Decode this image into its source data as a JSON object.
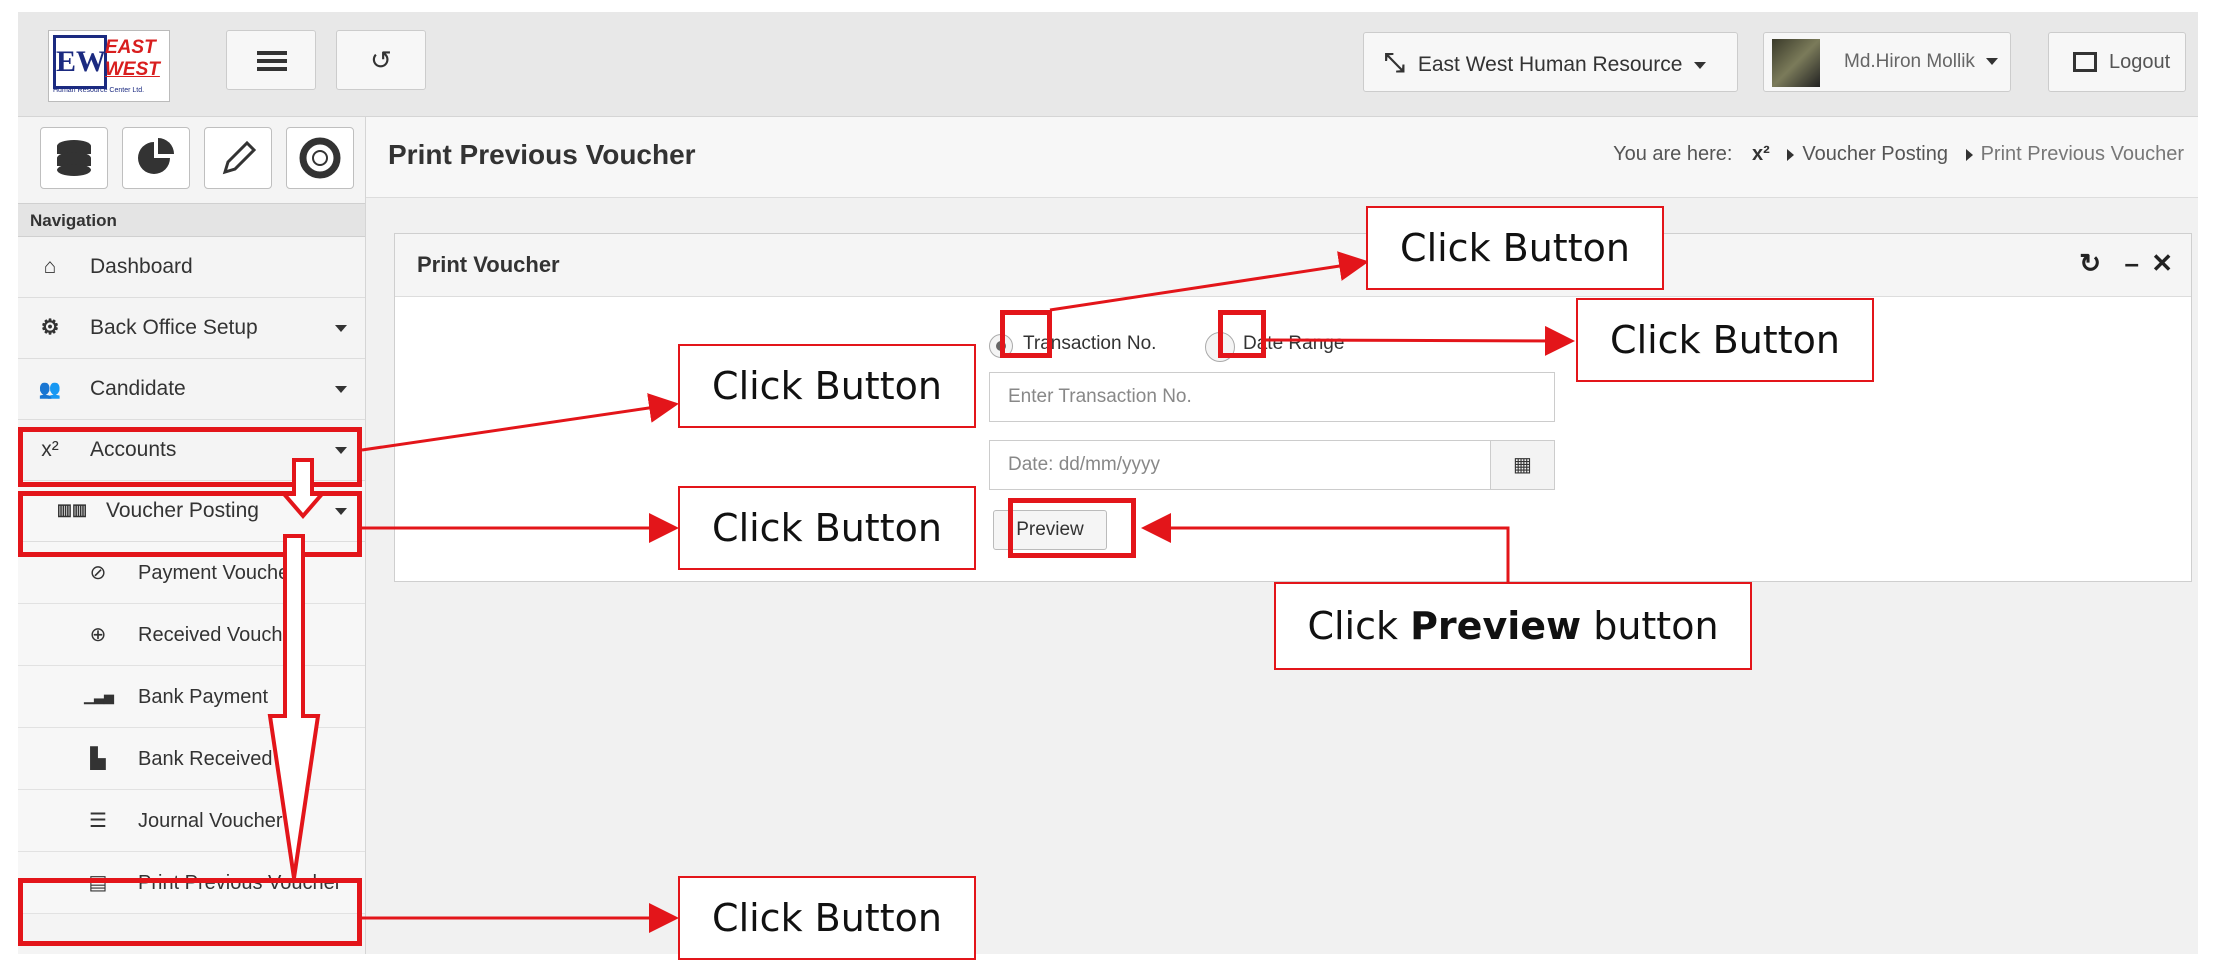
{
  "header": {
    "logo": {
      "mark": "EW",
      "line1": "EAST",
      "line2": "WEST",
      "tagline": "Human Resource Center Ltd."
    },
    "company_label": "East West Human Resource",
    "user_name": "Md.Hiron Mollik",
    "logout_label": "Logout"
  },
  "sidebar": {
    "nav_header": "Navigation",
    "items": [
      {
        "label": "Dashboard",
        "icon": "home-icon",
        "glyph": "⌂"
      },
      {
        "label": "Back Office Setup",
        "icon": "cogs-icon",
        "glyph": "⚙"
      },
      {
        "label": "Candidate",
        "icon": "users-icon",
        "glyph": "👥"
      },
      {
        "label": "Accounts",
        "icon": "superscript-icon",
        "glyph": "x²"
      },
      {
        "label": "Voucher Posting",
        "icon": "columns-icon",
        "glyph": "▥▥"
      }
    ],
    "sub_items": [
      {
        "label": "Payment Voucher",
        "icon": "compass-icon",
        "glyph": "⊘"
      },
      {
        "label": "Received Voucher",
        "icon": "download-icon",
        "glyph": "⊕"
      },
      {
        "label": "Bank Payment",
        "icon": "bar-chart-icon",
        "glyph": "▁▃▅"
      },
      {
        "label": "Bank Received",
        "icon": "building-icon",
        "glyph": "▙"
      },
      {
        "label": "Journal Voucher",
        "icon": "list-icon",
        "glyph": "☰"
      },
      {
        "label": "Print Previous Voucher",
        "icon": "document-icon",
        "glyph": "▤"
      }
    ]
  },
  "page": {
    "title": "Print Previous Voucher",
    "breadcrumb_prefix": "You are here:",
    "breadcrumb_home_glyph": "x²",
    "breadcrumb": [
      "Voucher Posting",
      "Print Previous Voucher"
    ]
  },
  "panel": {
    "title": "Print Voucher",
    "radio_transaction": "Transaction No.",
    "radio_date": "Date Range",
    "transaction_placeholder": "Enter Transaction No.",
    "date_placeholder": "Date: dd/mm/yyyy",
    "preview_label": "Preview"
  },
  "annotations": {
    "click_button": "Click Button",
    "preview_prefix": "Click ",
    "preview_bold": "Preview",
    "preview_suffix": " button"
  },
  "colors": {
    "annotation_red": "#e3151a"
  }
}
